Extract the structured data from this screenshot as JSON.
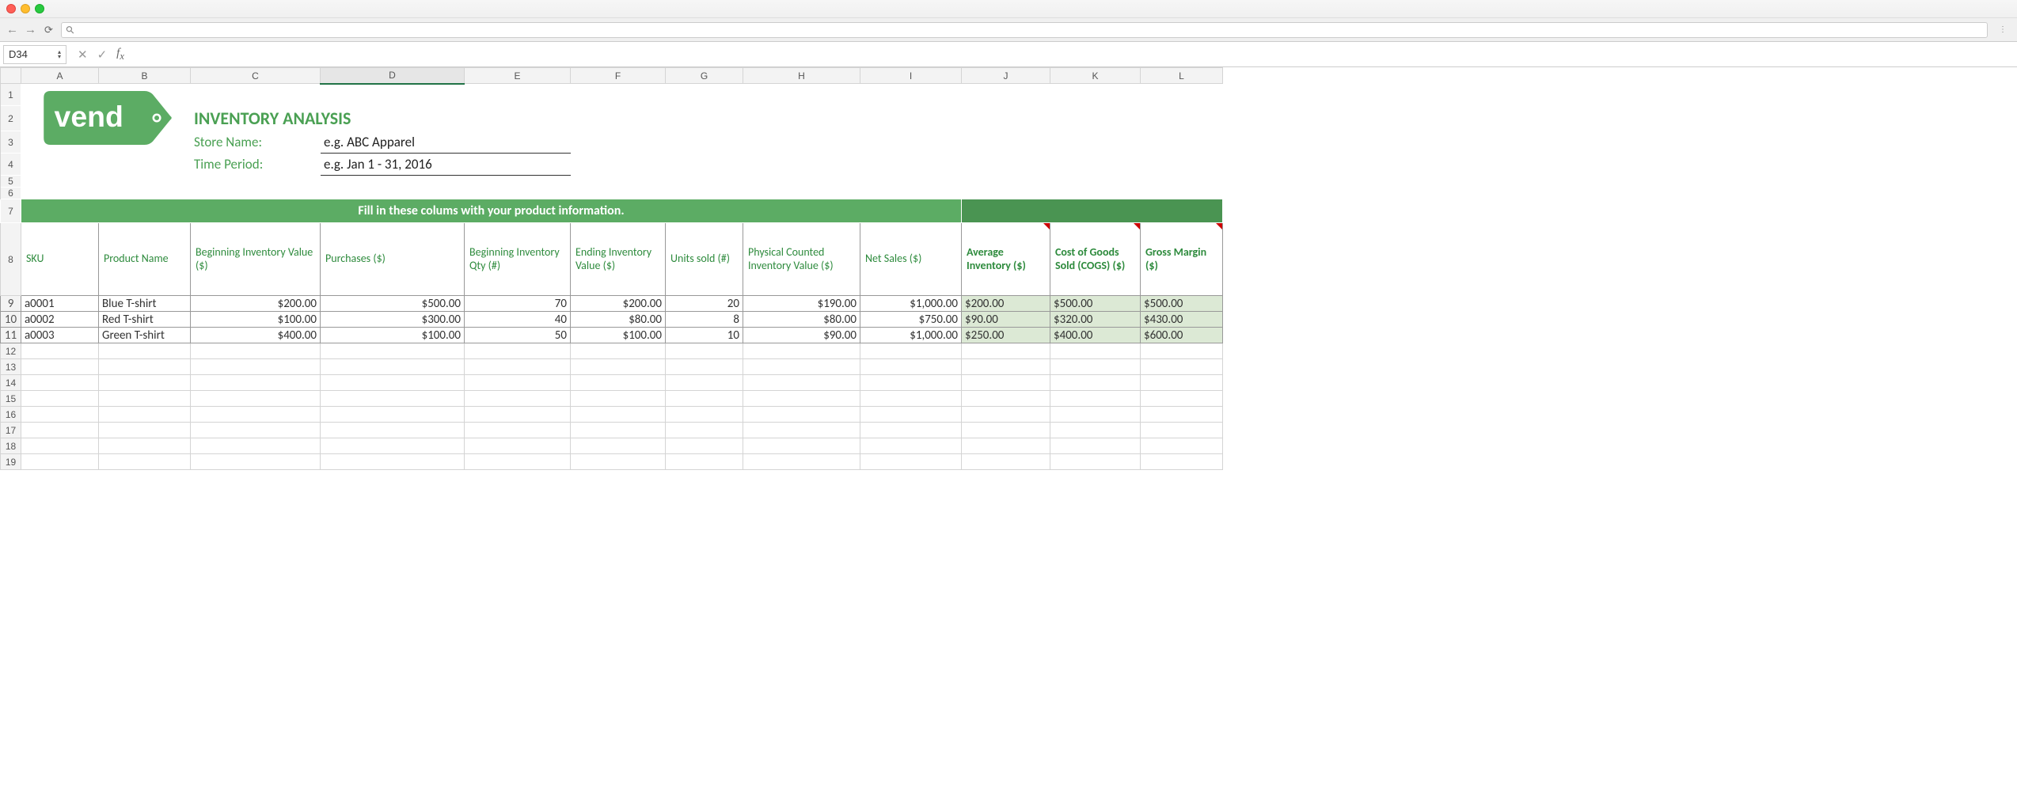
{
  "cell_ref": "D34",
  "url_icon": "⚲",
  "logo_text": "vend",
  "title": "INVENTORY ANALYSIS",
  "labels": {
    "store": "Store Name:",
    "period": "Time Period:"
  },
  "inputs": {
    "store": "e.g. ABC Apparel",
    "period": "e.g. Jan 1 - 31, 2016"
  },
  "banner": "Fill in these colums with your product information.",
  "col_letters": [
    "A",
    "B",
    "C",
    "D",
    "E",
    "F",
    "G",
    "H",
    "I",
    "J",
    "K",
    "L"
  ],
  "headers": {
    "sku": "SKU",
    "product": "Product Name",
    "beg_val": "Beginning Inventory Value ($)",
    "purchases": "Purchases ($)",
    "beg_qty": "Beginning Inventory Qty (#)",
    "end_val": "Ending Inventory Value ($)",
    "units": "Units sold (#)",
    "phys": "Physical Counted Inventory Value ($)",
    "netsales": "Net Sales ($)",
    "avg": "Average Inventory ($)",
    "cogs": "Cost of Goods Sold (COGS) ($)",
    "gm": "Gross Margin ($)"
  },
  "rows": [
    {
      "sku": "a0001",
      "product": "Blue T-shirt",
      "beg_val": "$200.00",
      "purchases": "$500.00",
      "beg_qty": "70",
      "end_val": "$200.00",
      "units": "20",
      "phys": "$190.00",
      "netsales": "$1,000.00",
      "avg": "$200.00",
      "cogs": "$500.00",
      "gm": "$500.00"
    },
    {
      "sku": "a0002",
      "product": "Red T-shirt",
      "beg_val": "$100.00",
      "purchases": "$300.00",
      "beg_qty": "40",
      "end_val": "$80.00",
      "units": "8",
      "phys": "$80.00",
      "netsales": "$750.00",
      "avg": "$90.00",
      "cogs": "$320.00",
      "gm": "$430.00"
    },
    {
      "sku": "a0003",
      "product": "Green T-shirt",
      "beg_val": "$400.00",
      "purchases": "$100.00",
      "beg_qty": "50",
      "end_val": "$100.00",
      "units": "10",
      "phys": "$90.00",
      "netsales": "$1,000.00",
      "avg": "$250.00",
      "cogs": "$400.00",
      "gm": "$600.00"
    }
  ],
  "chart_data": {
    "type": "table",
    "title": "INVENTORY ANALYSIS",
    "columns": [
      "SKU",
      "Product Name",
      "Beginning Inventory Value ($)",
      "Purchases ($)",
      "Beginning Inventory Qty (#)",
      "Ending Inventory Value ($)",
      "Units sold (#)",
      "Physical Counted Inventory Value ($)",
      "Net Sales ($)",
      "Average Inventory ($)",
      "Cost of Goods Sold (COGS) ($)",
      "Gross Margin ($)"
    ],
    "data": [
      [
        "a0001",
        "Blue T-shirt",
        200.0,
        500.0,
        70,
        200.0,
        20,
        190.0,
        1000.0,
        200.0,
        500.0,
        500.0
      ],
      [
        "a0002",
        "Red T-shirt",
        100.0,
        300.0,
        40,
        80.0,
        8,
        80.0,
        750.0,
        90.0,
        320.0,
        430.0
      ],
      [
        "a0003",
        "Green T-shirt",
        400.0,
        100.0,
        50,
        100.0,
        10,
        90.0,
        1000.0,
        250.0,
        400.0,
        600.0
      ]
    ]
  }
}
